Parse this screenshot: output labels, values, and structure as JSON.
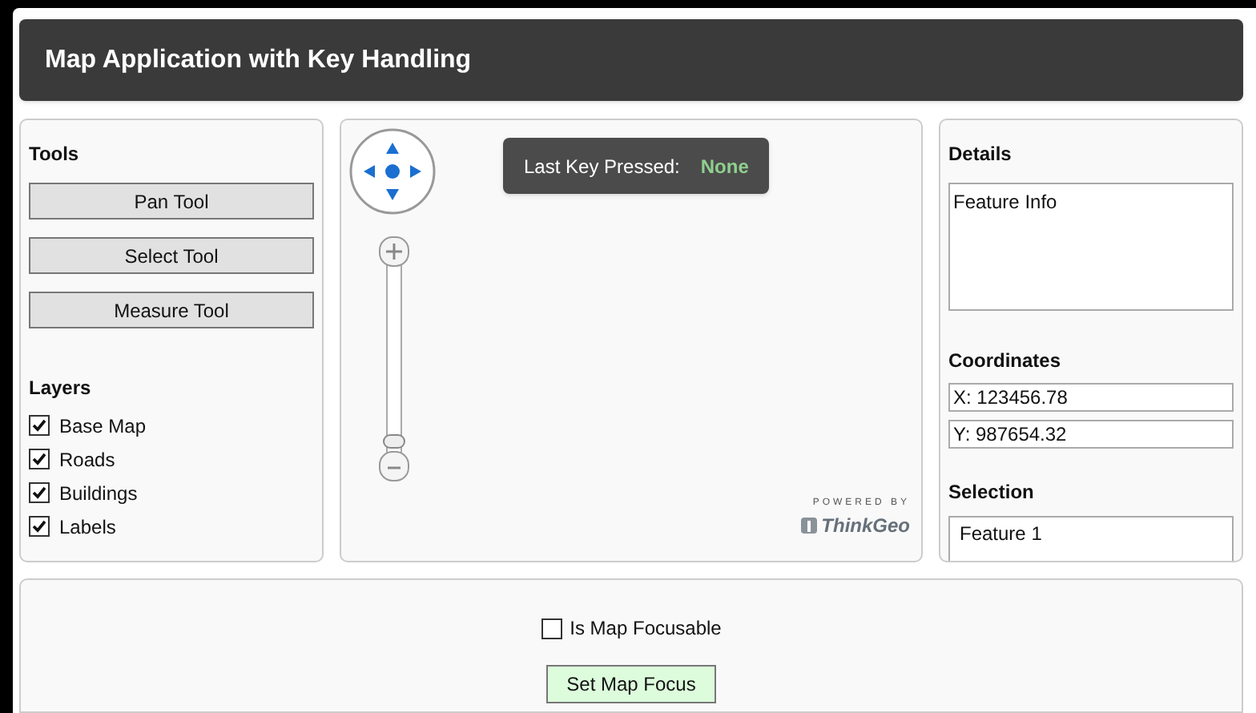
{
  "window": {
    "title": "Map Application with Key Handling"
  },
  "tools": {
    "heading": "Tools",
    "buttons": [
      "Pan Tool",
      "Select Tool",
      "Measure Tool"
    ]
  },
  "layers": {
    "heading": "Layers",
    "items": [
      {
        "label": "Base Map",
        "checked": true
      },
      {
        "label": "Roads",
        "checked": true
      },
      {
        "label": "Buildings",
        "checked": true
      },
      {
        "label": "Labels",
        "checked": true
      }
    ]
  },
  "map": {
    "last_key": {
      "label": "Last Key Pressed:",
      "value": "None"
    },
    "logo": {
      "caption": "POWERED BY",
      "brand": "ThinkGeo"
    }
  },
  "details": {
    "heading": "Details",
    "text": "Feature Info"
  },
  "coordinates": {
    "heading": "Coordinates",
    "x": "X: 123456.78",
    "y": "Y: 987654.32"
  },
  "selection": {
    "heading": "Selection",
    "items": [
      "Feature 1"
    ]
  },
  "focus": {
    "checkbox": {
      "label": "Is Map Focusable",
      "checked": false
    },
    "button": "Set Map Focus"
  }
}
